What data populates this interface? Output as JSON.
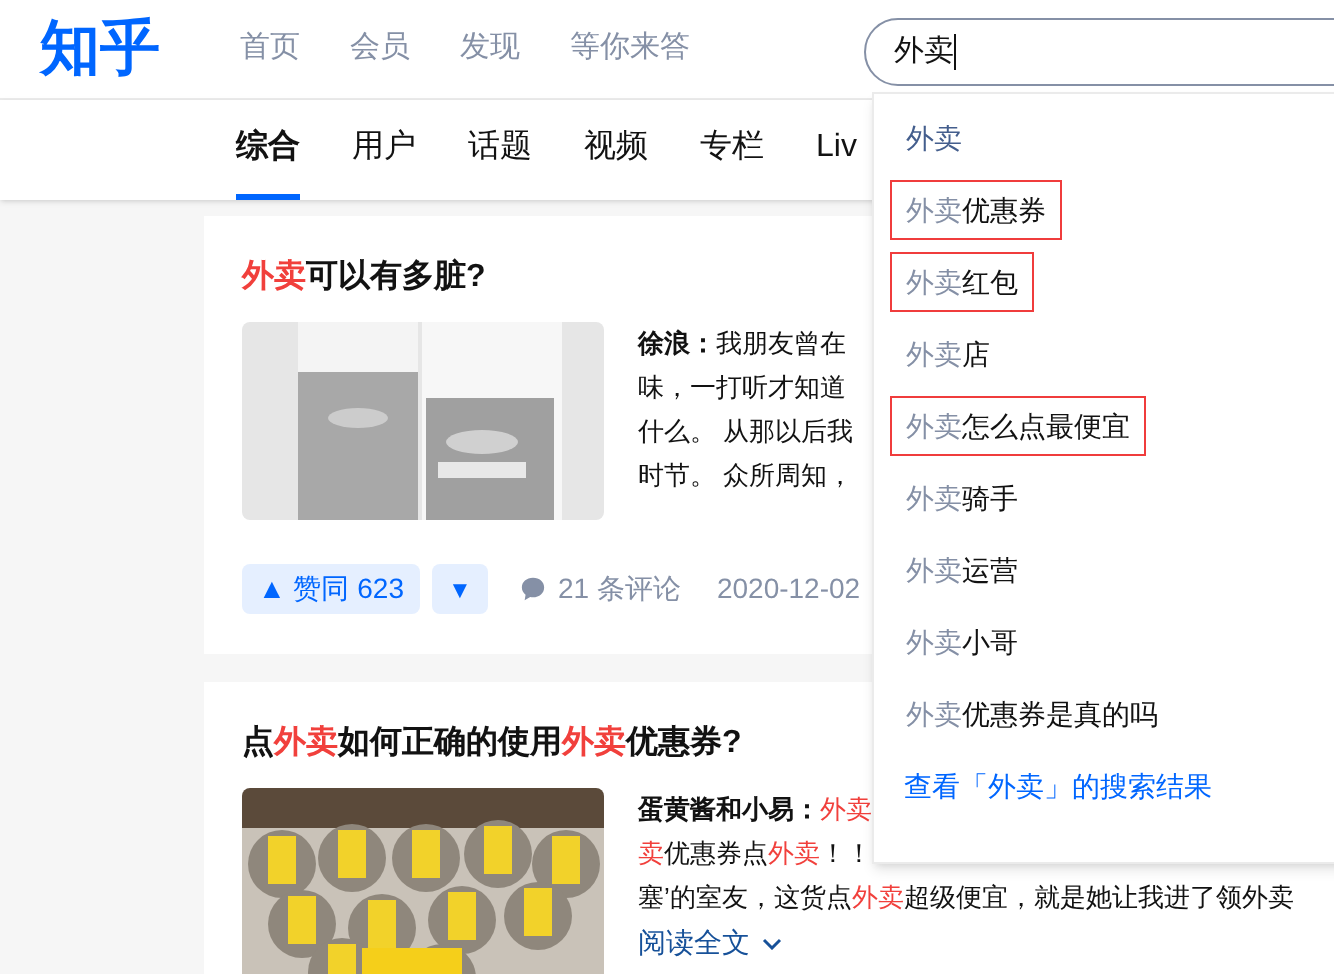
{
  "logo": "知乎",
  "nav": [
    {
      "label": "首页"
    },
    {
      "label": "会员"
    },
    {
      "label": "发现"
    },
    {
      "label": "等你来答"
    }
  ],
  "search": {
    "value": "外卖"
  },
  "tabs": [
    {
      "label": "综合",
      "selected": true
    },
    {
      "label": "用户",
      "selected": false
    },
    {
      "label": "话题",
      "selected": false
    },
    {
      "label": "视频",
      "selected": false
    },
    {
      "label": "专栏",
      "selected": false
    },
    {
      "label": "Liv",
      "selected": false
    }
  ],
  "results": [
    {
      "title": [
        {
          "text": "外卖",
          "hit": true
        },
        {
          "text": "可以有多脏?",
          "hit": false
        }
      ],
      "image": {
        "kind": "picture"
      },
      "excerpt": [
        [
          {
            "text": "徐浪：",
            "kind": "author"
          },
          {
            "text": "我朋友曾在",
            "kind": "plain"
          }
        ],
        [
          {
            "text": "味，一打听才知道",
            "kind": "plain"
          }
        ],
        [
          {
            "text": "什么。 从那以后我",
            "kind": "plain"
          }
        ],
        [
          {
            "text": "时节。 众所周知，",
            "kind": "plain"
          }
        ]
      ],
      "vote": {
        "up": "▲ 赞同 623",
        "down": "▼"
      },
      "comments": "21 条评论",
      "date": "2020-12-02"
    },
    {
      "title": [
        {
          "text": "点",
          "hit": false
        },
        {
          "text": "外卖",
          "hit": true
        },
        {
          "text": "如何正确的使用",
          "hit": false
        },
        {
          "text": "外卖",
          "hit": true
        },
        {
          "text": "优惠券?",
          "hit": false
        }
      ],
      "image": {
        "kind": "picture"
      },
      "excerpt": [
        [
          {
            "text": "蛋黄酱和小易：",
            "kind": "author"
          },
          {
            "text": "外卖",
            "kind": "hit"
          }
        ],
        [
          {
            "text": "卖",
            "kind": "hit"
          },
          {
            "text": "优惠券点",
            "kind": "plain"
          },
          {
            "text": "外卖",
            "kind": "hit"
          },
          {
            "text": "！！",
            "kind": "plain"
          }
        ],
        [
          {
            "text": "塞’的室友，这货点",
            "kind": "plain"
          },
          {
            "text": "外卖",
            "kind": "hit"
          },
          {
            "text": "超级便宜，就是她让我进了领外卖",
            "kind": "plain"
          }
        ]
      ],
      "read_more": "阅读全文"
    }
  ],
  "suggestions": {
    "items": [
      {
        "prefix": "外卖",
        "selected": true,
        "highlighted": false
      },
      {
        "prefix": "外卖",
        "rest": "优惠券",
        "selected": false,
        "highlighted": true
      },
      {
        "prefix": "外卖",
        "rest": "红包",
        "selected": false,
        "highlighted": true
      },
      {
        "prefix": "外卖",
        "rest": "店",
        "selected": false,
        "highlighted": false
      },
      {
        "prefix": "外卖",
        "rest": "怎么点最便宜",
        "selected": false,
        "highlighted": true
      },
      {
        "prefix": "外卖",
        "rest": "骑手",
        "selected": false,
        "highlighted": false
      },
      {
        "prefix": "外卖",
        "rest": "运营",
        "selected": false,
        "highlighted": false
      },
      {
        "prefix": "外卖",
        "rest": "小哥",
        "selected": false,
        "highlighted": false
      },
      {
        "prefix": "外卖",
        "rest": "优惠券是真的吗",
        "selected": false,
        "highlighted": false
      }
    ],
    "see_all": "查看「外卖」的搜索结果"
  }
}
